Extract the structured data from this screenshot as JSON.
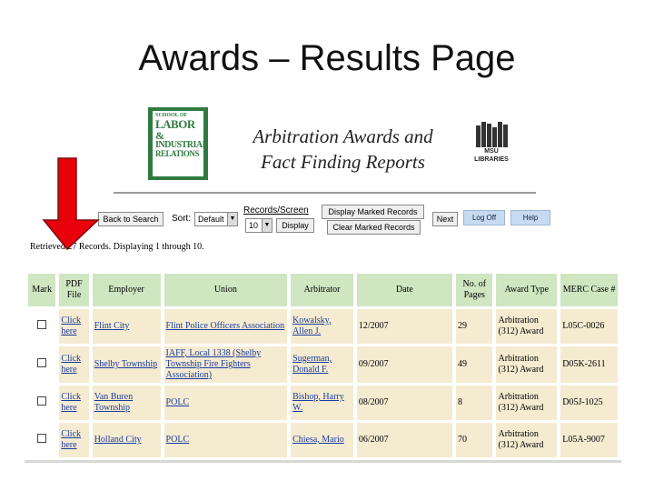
{
  "slide": {
    "title": "Awards – Results Page"
  },
  "header": {
    "school_logo": {
      "line1": "SCHOOL OF",
      "line2": "LABOR",
      "line3": "&",
      "line4": "INDUSTRIAL",
      "line5": "RELATIONS"
    },
    "title_line1": "Arbitration Awards and",
    "title_line2": "Fact Finding Reports",
    "libraries_logo": {
      "line1": "MSU",
      "line2": "LIBRARIES"
    }
  },
  "toolbar": {
    "back_to_search": "Back to Search",
    "sort_label": "Sort:",
    "sort_value": "Default",
    "records_per_screen_label": "Records/Screen",
    "records_per_screen_value": "10",
    "display_button": "Display",
    "display_marked_button": "Display Marked Records",
    "clear_marked_button": "Clear Marked Records",
    "next_button": "Next",
    "log_off_button": "Log Off",
    "help_button": "Help"
  },
  "results_info": "Retrieved 27 Records. Displaying 1 through 10.",
  "table": {
    "headers": {
      "mark": "Mark",
      "pdf_file": "PDF File",
      "employer": "Employer",
      "union": "Union",
      "arbitrator": "Arbitrator",
      "date": "Date",
      "pages": "No. of Pages",
      "award_type": "Award Type",
      "merc_case": "MERC Case #"
    },
    "rows": [
      {
        "pdf": "Click here",
        "employer": "Flint City",
        "union": "Flint Police Officers Association",
        "arbitrator": "Kowalsky, Allen J.",
        "date": "12/2007",
        "pages": "29",
        "award_type": "Arbitration (312) Award",
        "case": "L05C-0026"
      },
      {
        "pdf": "Click here",
        "employer": "Shelby Township",
        "union": "IAFF, Local 1338 (Shelby Township Fire Fighters Association)",
        "arbitrator": "Sugerman, Donald F.",
        "date": "09/2007",
        "pages": "49",
        "award_type": "Arbitration (312) Award",
        "case": "D05K-2611"
      },
      {
        "pdf": "Click here",
        "employer": "Van Buren Township",
        "union": "POLC",
        "arbitrator": "Bishop, Harry W.",
        "date": "08/2007",
        "pages": "8",
        "award_type": "Arbitration (312) Award",
        "case": "D05J-1025"
      },
      {
        "pdf": "Click here",
        "employer": "Holland City",
        "union": "POLC",
        "arbitrator": "Chiesa, Mario",
        "date": "06/2007",
        "pages": "70",
        "award_type": "Arbitration (312) Award",
        "case": "L05A-9007"
      }
    ]
  }
}
